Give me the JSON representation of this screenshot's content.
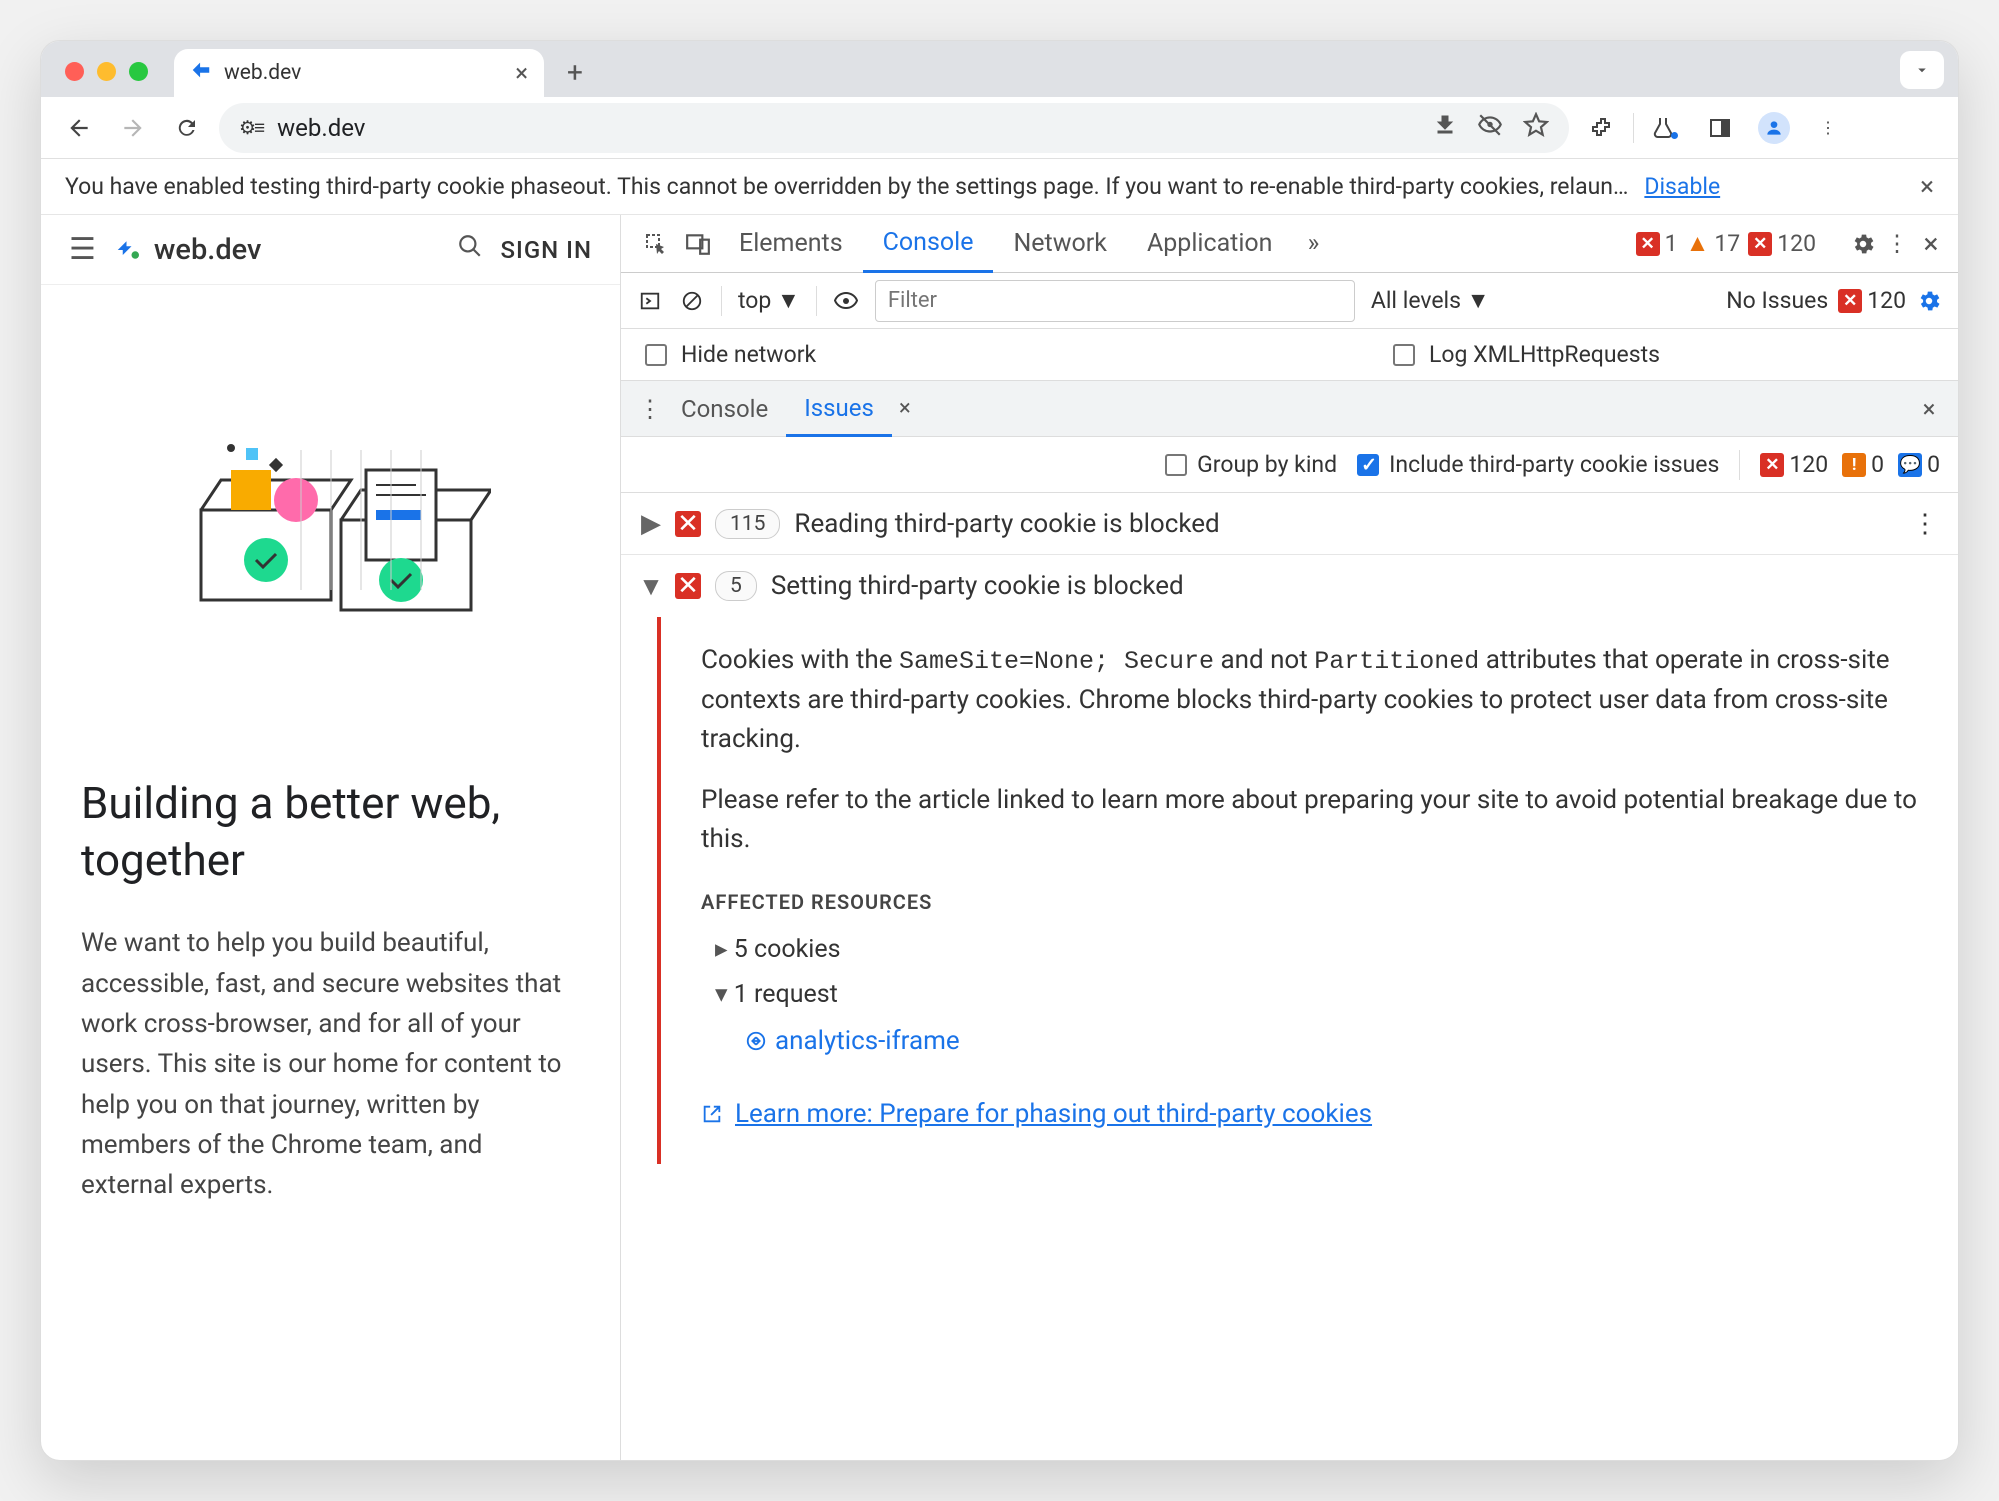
{
  "browser": {
    "tab_title": "web.dev",
    "address": "web.dev",
    "warning_text": "You have enabled testing third-party cookie phaseout. This cannot be overridden by the settings page. If you want to re-enable third-party cookies, relaun…",
    "warning_action": "Disable"
  },
  "page": {
    "brand": "web.dev",
    "signin": "SIGN IN",
    "heading": "Building a better web, together",
    "body": "We want to help you build beautiful, accessible, fast, and secure websites that work cross-browser, and for all of your users. This site is our home for content to help you on that journey, written by members of the Chrome team, and external experts."
  },
  "devtools": {
    "tabs": [
      "Elements",
      "Console",
      "Network",
      "Application"
    ],
    "active_tab": "Console",
    "error_count": 1,
    "warn_count": 17,
    "issue_count": 120,
    "context_label": "top",
    "filter_placeholder": "Filter",
    "levels_label": "All levels",
    "no_issues_label": "No Issues",
    "no_issues_count": 120,
    "hide_network": "Hide network",
    "log_xhr": "Log XMLHttpRequests",
    "drawer_tabs": [
      "Console",
      "Issues"
    ],
    "drawer_active": "Issues",
    "group_by_kind": "Group by kind",
    "include_3p": "Include third-party cookie issues",
    "counts": {
      "red": 120,
      "orange": 0,
      "blue": 0
    },
    "issues": [
      {
        "count": 115,
        "title": "Reading third-party cookie is blocked",
        "expanded": false
      },
      {
        "count": 5,
        "title": "Setting third-party cookie is blocked",
        "expanded": true
      }
    ],
    "detail": {
      "p1a": "Cookies with the ",
      "code1": "SameSite=None; Secure",
      "p1b": " and not ",
      "code2": "Partitioned",
      "p1c": " attributes that operate in cross-site contexts are third-party cookies. Chrome blocks third-party cookies to protect user data from cross-site tracking.",
      "p2": "Please refer to the article linked to learn more about preparing your site to avoid potential breakage due to this.",
      "affected_heading": "AFFECTED RESOURCES",
      "res_cookies": "5 cookies",
      "res_request": "1 request",
      "res_link": "analytics-iframe",
      "learn_more": "Learn more: Prepare for phasing out third-party cookies"
    }
  }
}
